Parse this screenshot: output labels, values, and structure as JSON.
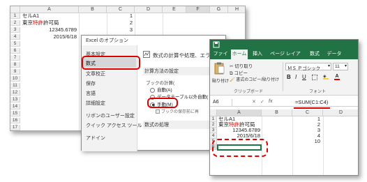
{
  "back_sheet": {
    "columns": [
      "A",
      "B",
      "C",
      "D",
      "E",
      "F",
      "G",
      "H"
    ],
    "rows": [
      "1",
      "2",
      "3",
      "4",
      "5",
      "6",
      "7",
      "8",
      "9",
      "10",
      "11",
      "12",
      "13",
      "14",
      "15",
      "16",
      "17"
    ],
    "cells": {
      "a1": "セルA1",
      "a2_pre": "東京",
      "a2_mid": "特許",
      "a2_post": "許可局",
      "a3": "12345.6789",
      "a4": "2015/6/18",
      "c1": "1",
      "c2": "2",
      "c3": "3",
      "c4": "4"
    }
  },
  "options_dialog": {
    "title": "Excel のオプション",
    "nav": [
      "基本設定",
      "数式",
      "文章校正",
      "保存",
      "言語",
      "詳細設定",
      "リボンのユーザー設定",
      "クイック アクセス ツール バー",
      "アドイン"
    ],
    "heading": "数式の計算や処理、エラ",
    "section_calc": "計算方法の設定",
    "book_calc_label": "ブックの計算(",
    "opt_auto": "自動(A)",
    "opt_auto_except": "データテーブル以外自動(",
    "opt_manual": "手動(M)",
    "opt_recalc": "ブックの保存前に再",
    "section_formula": "数式の処理"
  },
  "front_window": {
    "ribbon_tabs": [
      "ファイル",
      "ホーム",
      "挿入",
      "ページ レイアウト",
      "数式",
      "データ"
    ],
    "active_tab": "ホーム",
    "paste_label": "貼り付け",
    "cut_label": "切り取り",
    "copy_label": "コピー",
    "format_painter_label": "書式のコピー/貼り付け",
    "clipboard_group": "クリップボード",
    "font_name": "ＭＳ Ｐゴシック",
    "font_size": "11",
    "font_group": "フォント",
    "bold": "B",
    "italic": "I",
    "underline": "U",
    "name_box": "A6",
    "fx": "fx",
    "formula": "=SUM(C1:C4)",
    "columns": [
      "A",
      "B",
      "C",
      "D"
    ],
    "rows": [
      "1",
      "2",
      "3",
      "4",
      "5",
      "6"
    ],
    "cells": {
      "a1": "セルA1",
      "a2_pre": "東京",
      "a2_mid": "特許",
      "a2_post": "許可局",
      "a3": "12345.6789",
      "a4": "2015/6/18",
      "c1": "1",
      "c2": "2",
      "c3": "3",
      "c4": "4",
      "c5": "10"
    }
  },
  "colors": {
    "excel_green": "#217346",
    "highlight_red": "#e00000"
  }
}
